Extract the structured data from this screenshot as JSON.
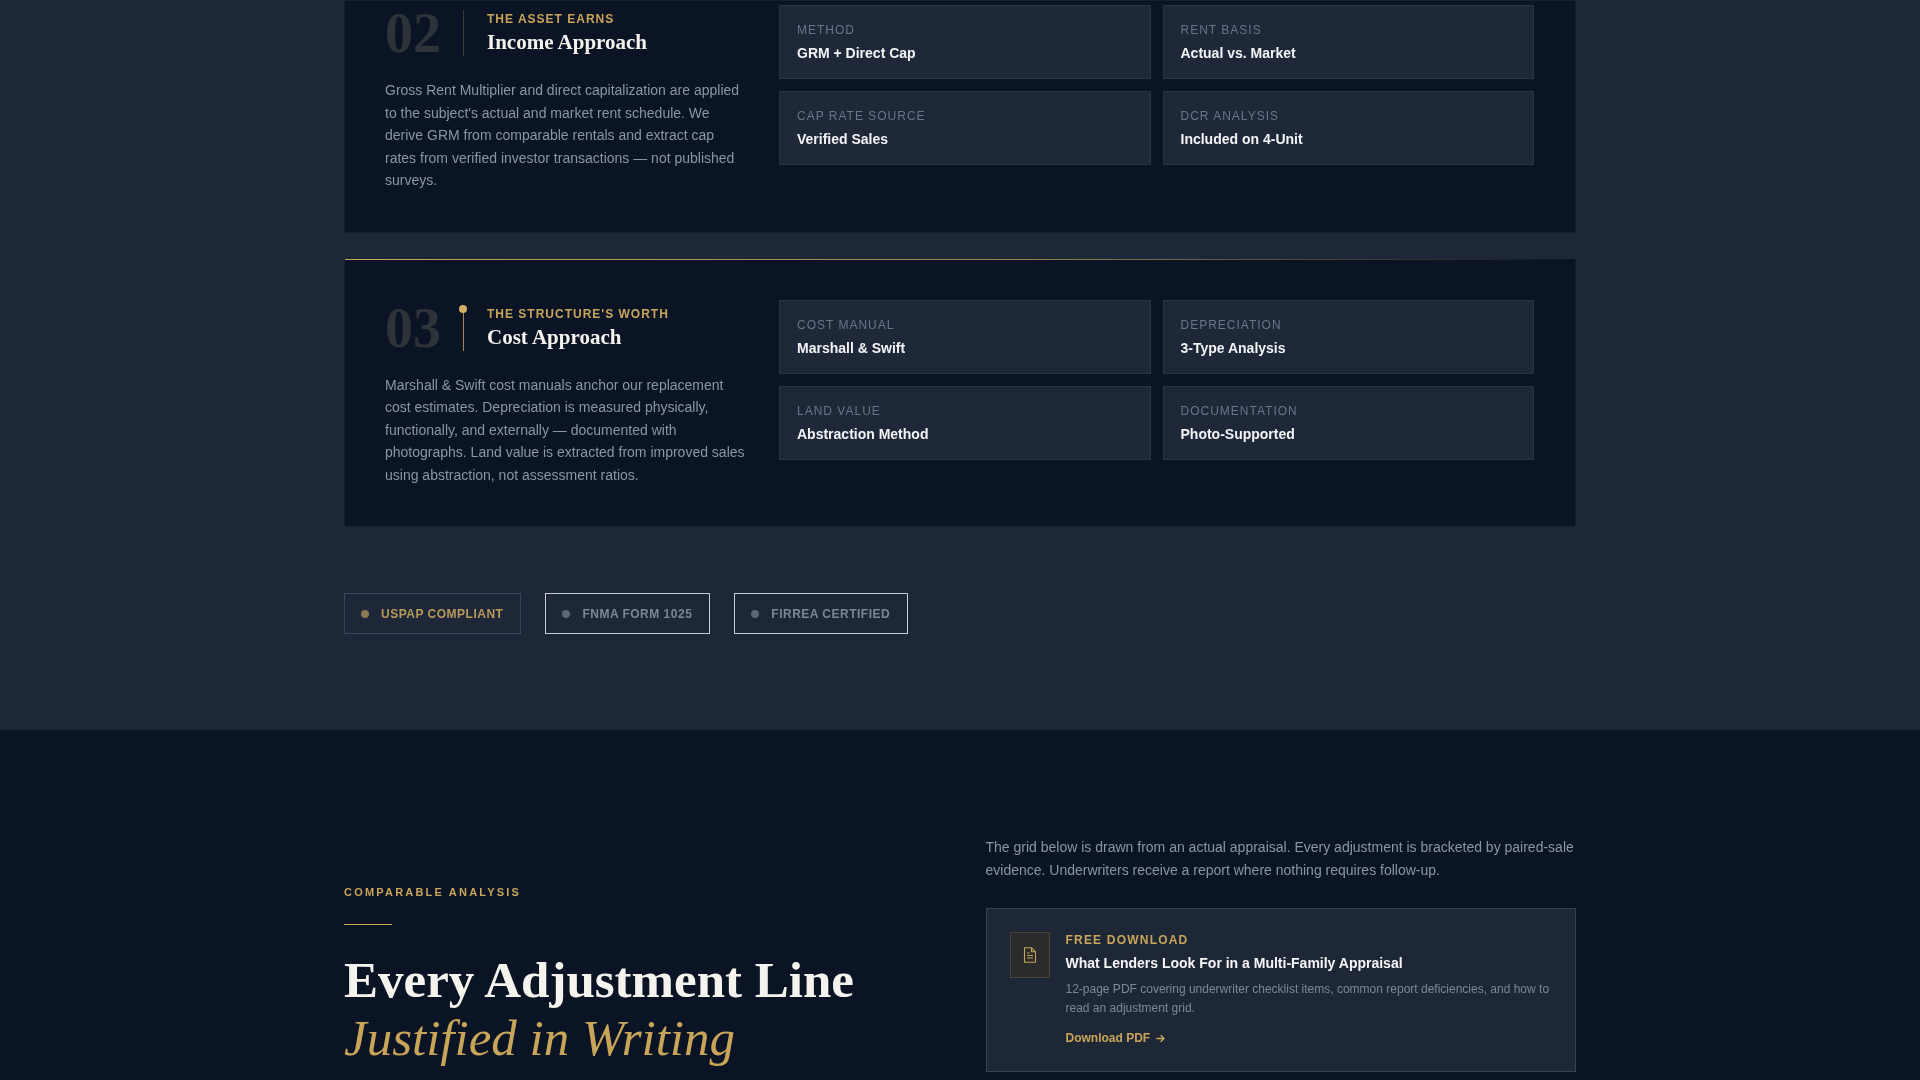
{
  "steps": [
    {
      "number": "02",
      "eyebrow": "THE ASSET EARNS",
      "title": "Income Approach",
      "active": false,
      "description": "Gross Rent Multiplier and direct capitalization are applied to the subject's actual and market rent schedule. We derive GRM from comparable rentals and extract cap rates from verified investor transactions — not published surveys.",
      "facts": [
        {
          "label": "METHOD",
          "value": "GRM + Direct Cap"
        },
        {
          "label": "RENT BASIS",
          "value": "Actual vs. Market"
        },
        {
          "label": "CAP RATE SOURCE",
          "value": "Verified Sales"
        },
        {
          "label": "DCR ANALYSIS",
          "value": "Included on 4-Unit"
        }
      ]
    },
    {
      "number": "03",
      "eyebrow": "THE STRUCTURE'S WORTH",
      "title": "Cost Approach",
      "active": true,
      "description": "Marshall & Swift cost manuals anchor our replacement cost estimates. Depreciation is measured physically, functionally, and externally — documented with photographs. Land value is extracted from improved sales using abstraction, not assessment ratios.",
      "facts": [
        {
          "label": "COST MANUAL",
          "value": "Marshall & Swift"
        },
        {
          "label": "DEPRECIATION",
          "value": "3-Type Analysis"
        },
        {
          "label": "LAND VALUE",
          "value": "Abstraction Method"
        },
        {
          "label": "DOCUMENTATION",
          "value": "Photo-Supported"
        }
      ]
    }
  ],
  "badges": [
    {
      "label": "USPAP COMPLIANT",
      "selected": true
    },
    {
      "label": "FNMA FORM 1025",
      "selected": false
    },
    {
      "label": "FIRREA CERTIFIED",
      "selected": false
    }
  ],
  "comparable": {
    "eyebrow": "COMPARABLE ANALYSIS",
    "heading": "Every Adjustment Line *Justified in Writing*",
    "intro": "The grid below is drawn from an actual appraisal. Every adjustment is bracketed by paired-sale evidence. Underwriters receive a report where nothing requires follow-up.",
    "download": {
      "eyebrow": "FREE DOWNLOAD",
      "title": "What Lenders Look For in a Multi-Family Appraisal",
      "description": "12-page PDF covering underwriter checklist items, common report deficiencies, and how to read an adjustment grid.",
      "link": "Download PDF"
    }
  }
}
